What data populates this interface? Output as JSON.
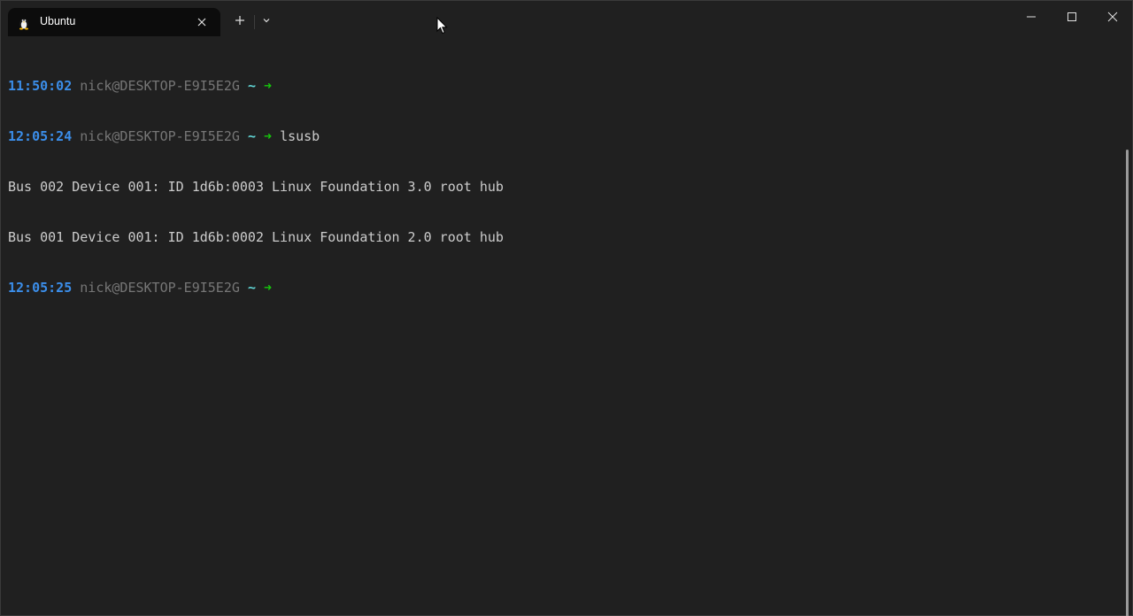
{
  "titlebar": {
    "tab": {
      "title": "Ubuntu",
      "icon": "linux-penguin-icon"
    },
    "new_tab_icon": "plus-icon",
    "dropdown_icon": "chevron-down-icon",
    "caption_buttons": [
      "minimize-icon",
      "maximize-icon",
      "close-icon"
    ]
  },
  "terminal": {
    "lines": [
      {
        "time": "11:50:02",
        "host": "nick@DESKTOP-E9I5E2G",
        "tilde": "~",
        "arrow": "➜",
        "cmd": ""
      },
      {
        "time": "12:05:24",
        "host": "nick@DESKTOP-E9I5E2G",
        "tilde": "~",
        "arrow": "➜",
        "cmd": "lsusb"
      },
      {
        "output": "Bus 002 Device 001: ID 1d6b:0003 Linux Foundation 3.0 root hub"
      },
      {
        "output": "Bus 001 Device 001: ID 1d6b:0002 Linux Foundation 2.0 root hub"
      },
      {
        "time": "12:05:25",
        "host": "nick@DESKTOP-E9I5E2G",
        "tilde": "~",
        "arrow": "➜",
        "cmd": ""
      }
    ]
  },
  "colors": {
    "background": "#202020",
    "tab_background": "#0c0c0c",
    "time": "#3b8eea",
    "host": "#767676",
    "tilde": "#61d6d6",
    "arrow": "#16c60c",
    "text": "#cccccc"
  }
}
